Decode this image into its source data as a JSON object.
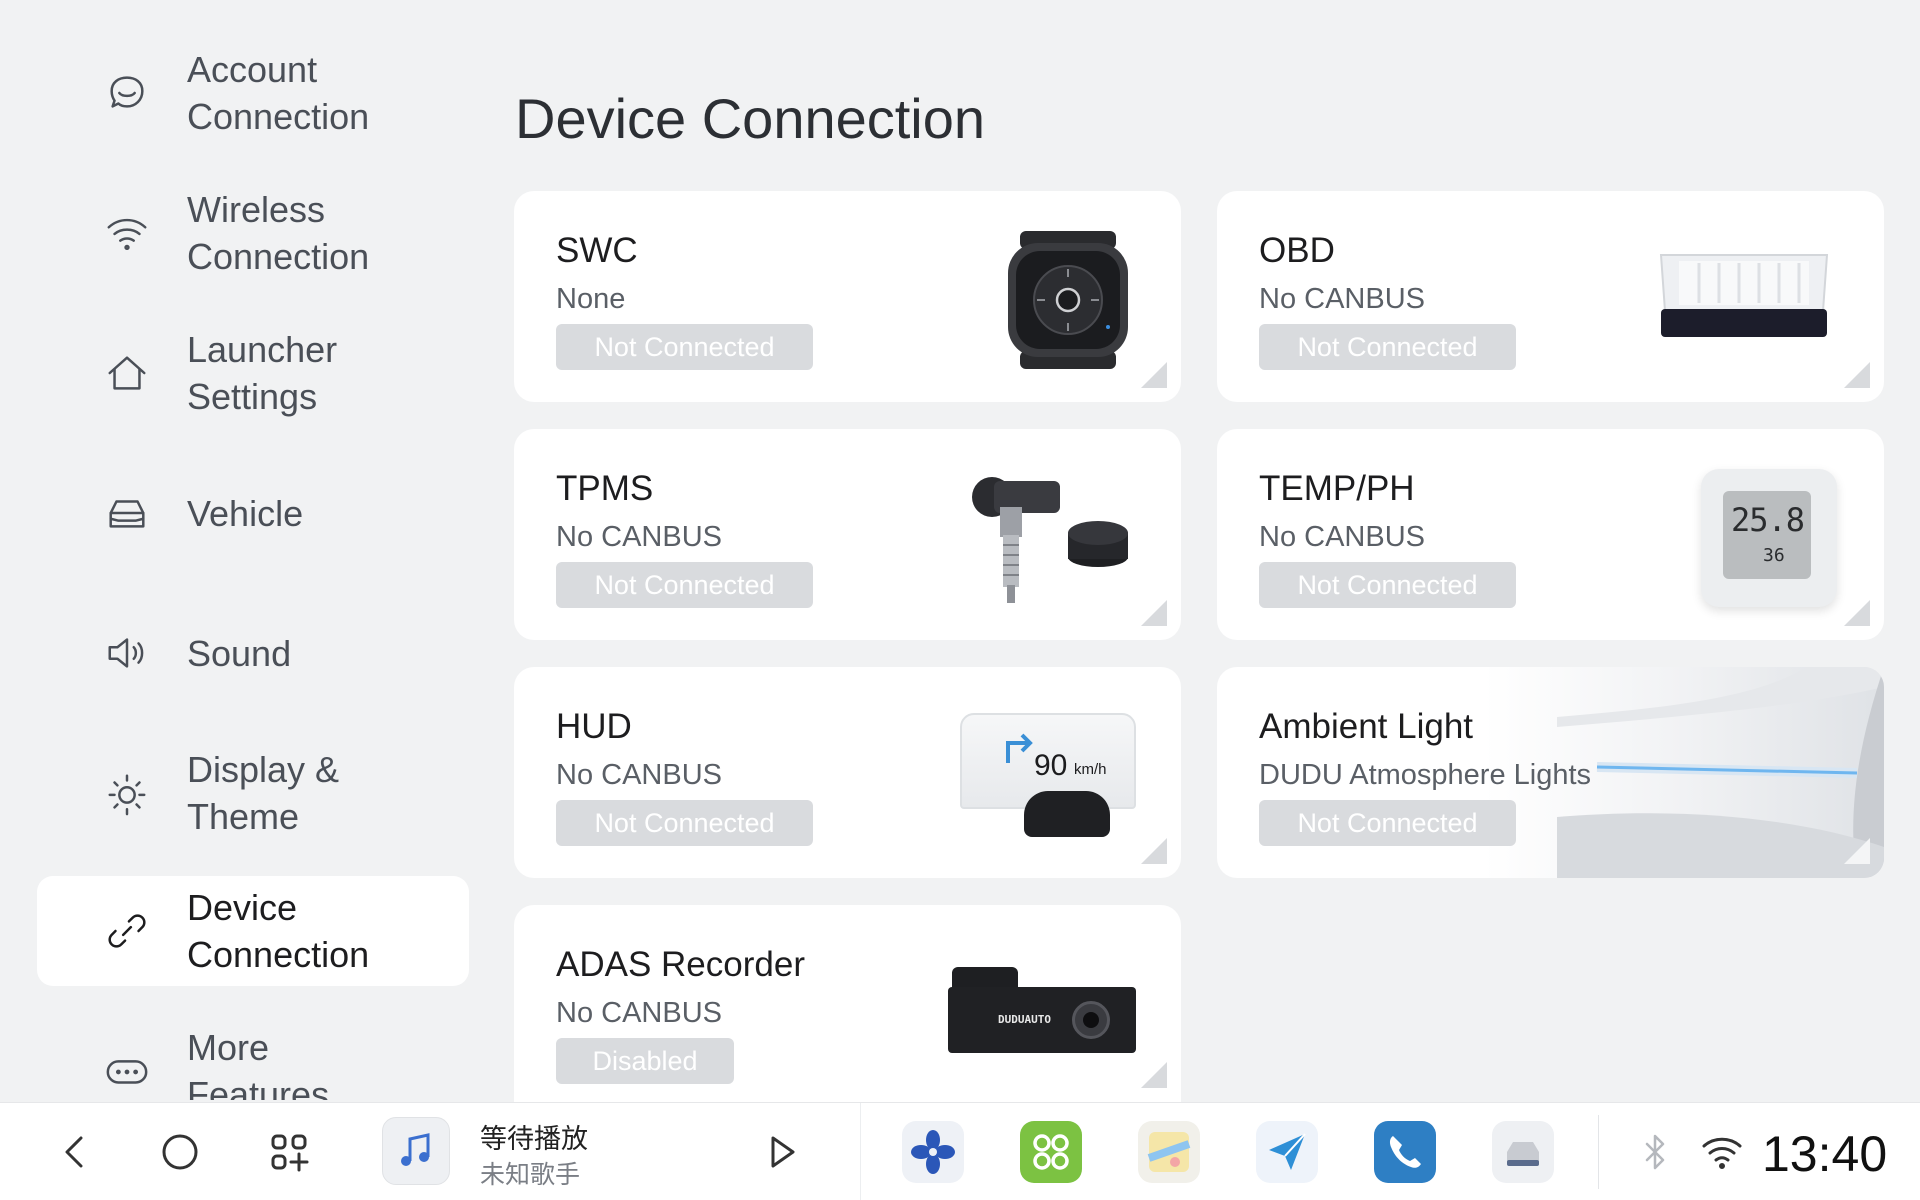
{
  "sidebar": {
    "items": [
      {
        "label": "Account\nConnection",
        "icon": "account-icon",
        "active": false
      },
      {
        "label": "Wireless\nConnection",
        "icon": "wifi-icon",
        "active": false
      },
      {
        "label": "Launcher\nSettings",
        "icon": "home-icon",
        "active": false
      },
      {
        "label": "Vehicle",
        "icon": "car-icon",
        "active": false
      },
      {
        "label": "Sound",
        "icon": "speaker-icon",
        "active": false
      },
      {
        "label": "Display &\nTheme",
        "icon": "sun-icon",
        "active": false
      },
      {
        "label": "Device\nConnection",
        "icon": "link-icon",
        "active": true
      },
      {
        "label": "More\nFeatures",
        "icon": "more-icon",
        "active": false
      }
    ]
  },
  "main": {
    "title": "Device Connection",
    "cards": [
      {
        "title": "SWC",
        "subtitle": "None",
        "status": "Not Connected",
        "image": "steering-wheel-controller"
      },
      {
        "title": "OBD",
        "subtitle": "No CANBUS",
        "status": "Not Connected",
        "image": "obd-module"
      },
      {
        "title": "TPMS",
        "subtitle": "No CANBUS",
        "status": "Not Connected",
        "image": "tire-pressure-sensors"
      },
      {
        "title": "TEMP/PH",
        "subtitle": "No CANBUS",
        "status": "Not Connected",
        "image": "thermometer-hygrometer",
        "display": {
          "temp": "25.8",
          "humidity": "36"
        }
      },
      {
        "title": "HUD",
        "subtitle": "No CANBUS",
        "status": "Not Connected",
        "image": "head-up-display",
        "display": {
          "speed": "90",
          "unit": "km/h"
        }
      },
      {
        "title": "Ambient Light",
        "subtitle": "DUDU Atmosphere Lights",
        "status": "Not Connected",
        "image": "ambient-light-strip"
      },
      {
        "title": "ADAS Recorder",
        "subtitle": "No CANBUS",
        "status": "Disabled",
        "image": "dash-camera",
        "brand": "DUDUAUTO"
      }
    ]
  },
  "dock": {
    "music_title": "等待播放",
    "music_artist": "未知歌手",
    "apps": [
      "fan-icon",
      "apps-grid-icon",
      "maps-icon",
      "navigation-icon",
      "phone-icon",
      "car-settings-icon"
    ],
    "time": "13:40"
  },
  "colors": {
    "background": "#f1f2f3",
    "card": "#ffffff",
    "status_badge": "#d9dbde",
    "app_green": "#7cc242",
    "app_blue": "#2e8fd6"
  }
}
